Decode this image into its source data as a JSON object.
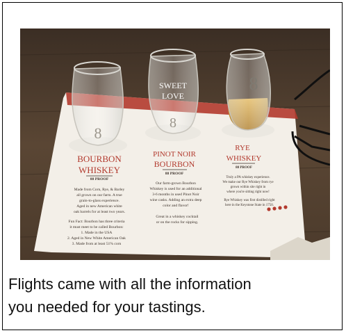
{
  "caption": {
    "line1": "Flights came with all the information",
    "line2": "you needed for your tastings."
  },
  "placemat": {
    "col1": {
      "name1": "BOURBON",
      "name2": "WHISKEY",
      "proof": "88 PROOF",
      "desc1": "Made from Corn, Rye, & Barley",
      "desc2": "all grown on our farm. A true",
      "desc3": "grain-to-glass experience.",
      "desc4": "Aged in new American white",
      "desc5": "oak barrels for at least two years.",
      "fact1": "Fun Fact: Bourbon has three criteria",
      "fact2": "it must meet to be called Bourbon:",
      "fact3": "1.       Made in the USA",
      "fact4": "2. Aged in New White American Oak",
      "fact5": "3.   Made from at least 51% corn"
    },
    "col2": {
      "name1": "PINOT NOIR",
      "name2": "BOURBON",
      "proof": "88 PROOF",
      "desc1": "Our farm-grown Bourbon",
      "desc2": "Whiskey is used for an additional",
      "desc3": "3-6 months in used Pinot Noir",
      "desc4": "wine casks. Adding an extra deep",
      "desc5": "color and flavor!",
      "desc6": "Great in a whiskey cocktail",
      "desc7": "or on the rocks for sipping."
    },
    "col3": {
      "name1": "RYE",
      "name2": "WHISKEY",
      "proof": "88 PROOF",
      "desc1": "Truly a PA whiskey experience.",
      "desc2": "We make our Rye Whiskey from rye",
      "desc3": "grown within site right in",
      "desc4": "where you're sitting right now!",
      "desc5": "Rye Whiskey was first distilled right",
      "desc6": "here in the Keystone State in 1750."
    },
    "glass_logo": "8",
    "glass_text1": "SWEET",
    "glass_text2": "LOVE"
  },
  "colors": {
    "table": "#4a3a2c",
    "placemat": "#f3efe8",
    "accent_red": "#b23a2e",
    "liquor": "#c8952e"
  }
}
